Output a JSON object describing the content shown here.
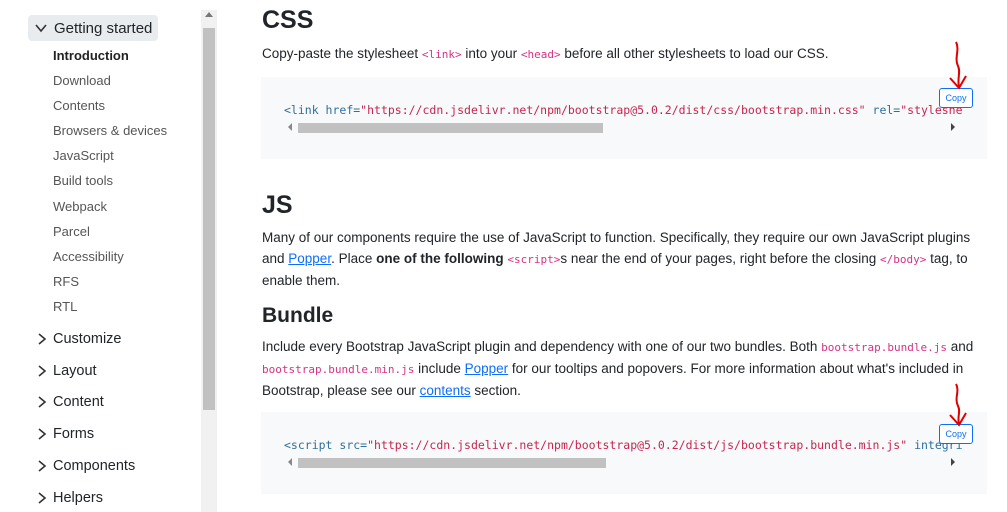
{
  "sidebar": {
    "open_group": {
      "label": "Getting started",
      "items": [
        "Introduction",
        "Download",
        "Contents",
        "Browsers & devices",
        "JavaScript",
        "Build tools",
        "Webpack",
        "Parcel",
        "Accessibility",
        "RFS",
        "RTL"
      ]
    },
    "groups": [
      "Customize",
      "Layout",
      "Content",
      "Forms",
      "Components",
      "Helpers"
    ]
  },
  "css_section": {
    "title": "CSS",
    "p_pre": "Copy-paste the stylesheet ",
    "code1": "<link>",
    "p_mid": " into your ",
    "code2": "<head>",
    "p_post": " before all other stylesheets to load our CSS.",
    "code": {
      "tag_open": "<link",
      "attr1": " href=",
      "val1": "\"https://cdn.jsdelivr.net/npm/bootstrap@5.0.2/dist/css/bootstrap.min.css\"",
      "attr2": " rel=",
      "val2": "\"styleshe"
    },
    "copy_label": "Copy"
  },
  "js_section": {
    "title": "JS",
    "p1": "Many of our components require the use of JavaScript to function. Specifically, they require our own JavaScript plugins and ",
    "popper": "Popper",
    "p2": ". Place ",
    "bold": "one of the following ",
    "script_code": "<script>",
    "p3": "s near the end of your pages, right before the closing ",
    "body_code": "</body>",
    "p4": " tag, to enable them."
  },
  "bundle_section": {
    "title": "Bundle",
    "p1": "Include every Bootstrap JavaScript plugin and dependency with one of our two bundles. Both ",
    "code1": "bootstrap.bundle.js",
    "and": " and ",
    "code2": "bootstrap.bundle.min.js",
    "p2": " include ",
    "popper": "Popper",
    "p3": " for our tooltips and popovers. For more information about what's included in Bootstrap, please see our ",
    "contents": "contents",
    "p4": " section.",
    "code": {
      "tag_open": "<script",
      "attr1": " src=",
      "val1": "\"https://cdn.jsdelivr.net/npm/bootstrap@5.0.2/dist/js/bootstrap.bundle.min.js\"",
      "attr2": " integri"
    },
    "copy_label": "Copy"
  },
  "colors": {
    "accent": "#0d6efd",
    "code_pink": "#d63384",
    "annotation_red": "#e00000"
  }
}
